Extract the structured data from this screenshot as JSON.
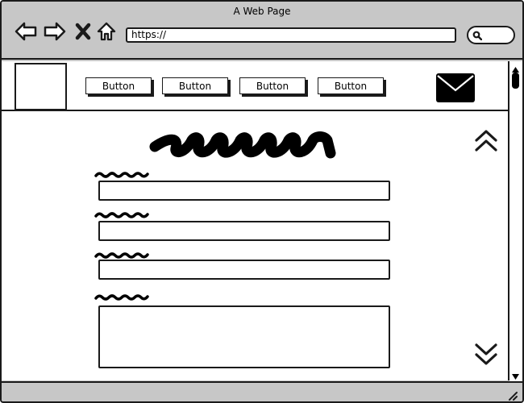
{
  "window": {
    "title": "A Web Page"
  },
  "toolbar": {
    "icons": [
      "back-arrow-icon",
      "forward-arrow-icon",
      "close-x-icon",
      "home-icon"
    ],
    "url_value": "https://",
    "search_icon": "search-icon"
  },
  "header": {
    "logo": "logo-placeholder",
    "buttons": [
      {
        "label": "Button"
      },
      {
        "label": "Button"
      },
      {
        "label": "Button"
      },
      {
        "label": "Button"
      }
    ],
    "mail_icon": "envelope-icon"
  },
  "form": {
    "heading": "squiggle-placeholder",
    "fields": [
      {
        "label": "squiggle-placeholder",
        "value": ""
      },
      {
        "label": "squiggle-placeholder",
        "value": ""
      },
      {
        "label": "squiggle-placeholder",
        "value": ""
      }
    ],
    "textarea": {
      "label": "squiggle-placeholder",
      "value": ""
    }
  },
  "scroll_controls": {
    "up_icon": "double-chevron-up-icon",
    "down_icon": "double-chevron-down-icon"
  },
  "colors": {
    "chrome": "#c7c7c7",
    "ink": "#1a1a1a",
    "page": "#ffffff"
  }
}
